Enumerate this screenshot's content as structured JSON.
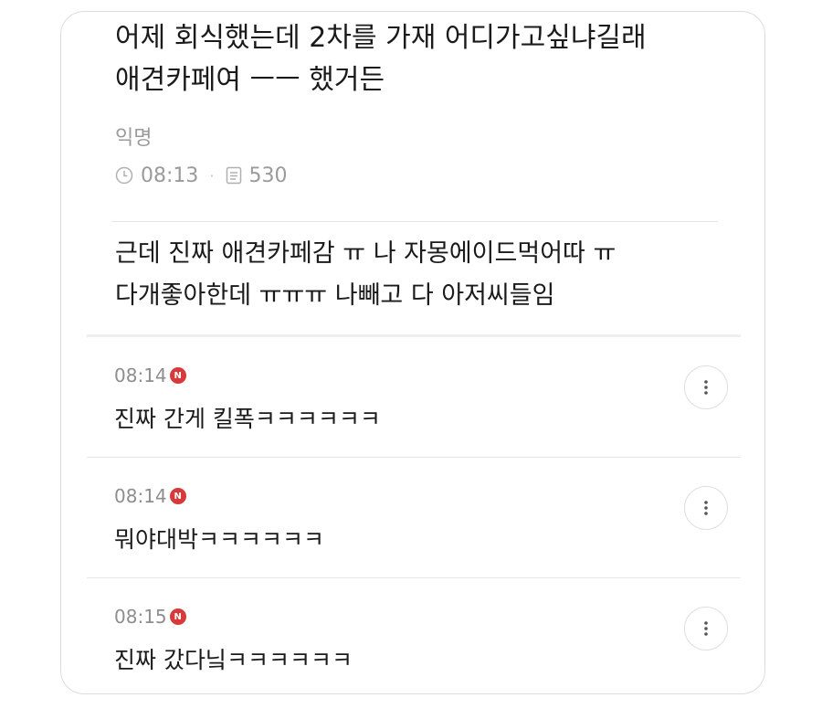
{
  "post": {
    "title_lines": [
      "어제 회식했는데 2차를 가재 어디가고싶냐길래",
      "애견카페여 ㅡㅡ 했거든"
    ],
    "author": "익명",
    "time": "08:13",
    "views": "530",
    "body_lines": [
      "근데 진짜 애견카페감 ㅠ 나 자몽에이드먹어따 ㅠ",
      "다개좋아한데 ㅠㅠㅠ 나빼고 다 아저씨들임"
    ]
  },
  "comments": [
    {
      "time": "08:14",
      "badge": "N",
      "text": "진짜 간게 킬폭ㅋㅋㅋㅋㅋㅋ"
    },
    {
      "time": "08:14",
      "badge": "N",
      "text": "뭐야대박ㅋㅋㅋㅋㅋㅋ"
    },
    {
      "time": "08:15",
      "badge": "N",
      "text": "진짜 갔다닠ㅋㅋㅋㅋㅋㅋ"
    }
  ],
  "icons": {
    "time": "clock-icon",
    "views": "document-icon",
    "more": "more-vertical-icon",
    "new": "new-badge"
  },
  "colors": {
    "new_badge": "#d63a3a",
    "meta_text": "#9a9a9a"
  }
}
